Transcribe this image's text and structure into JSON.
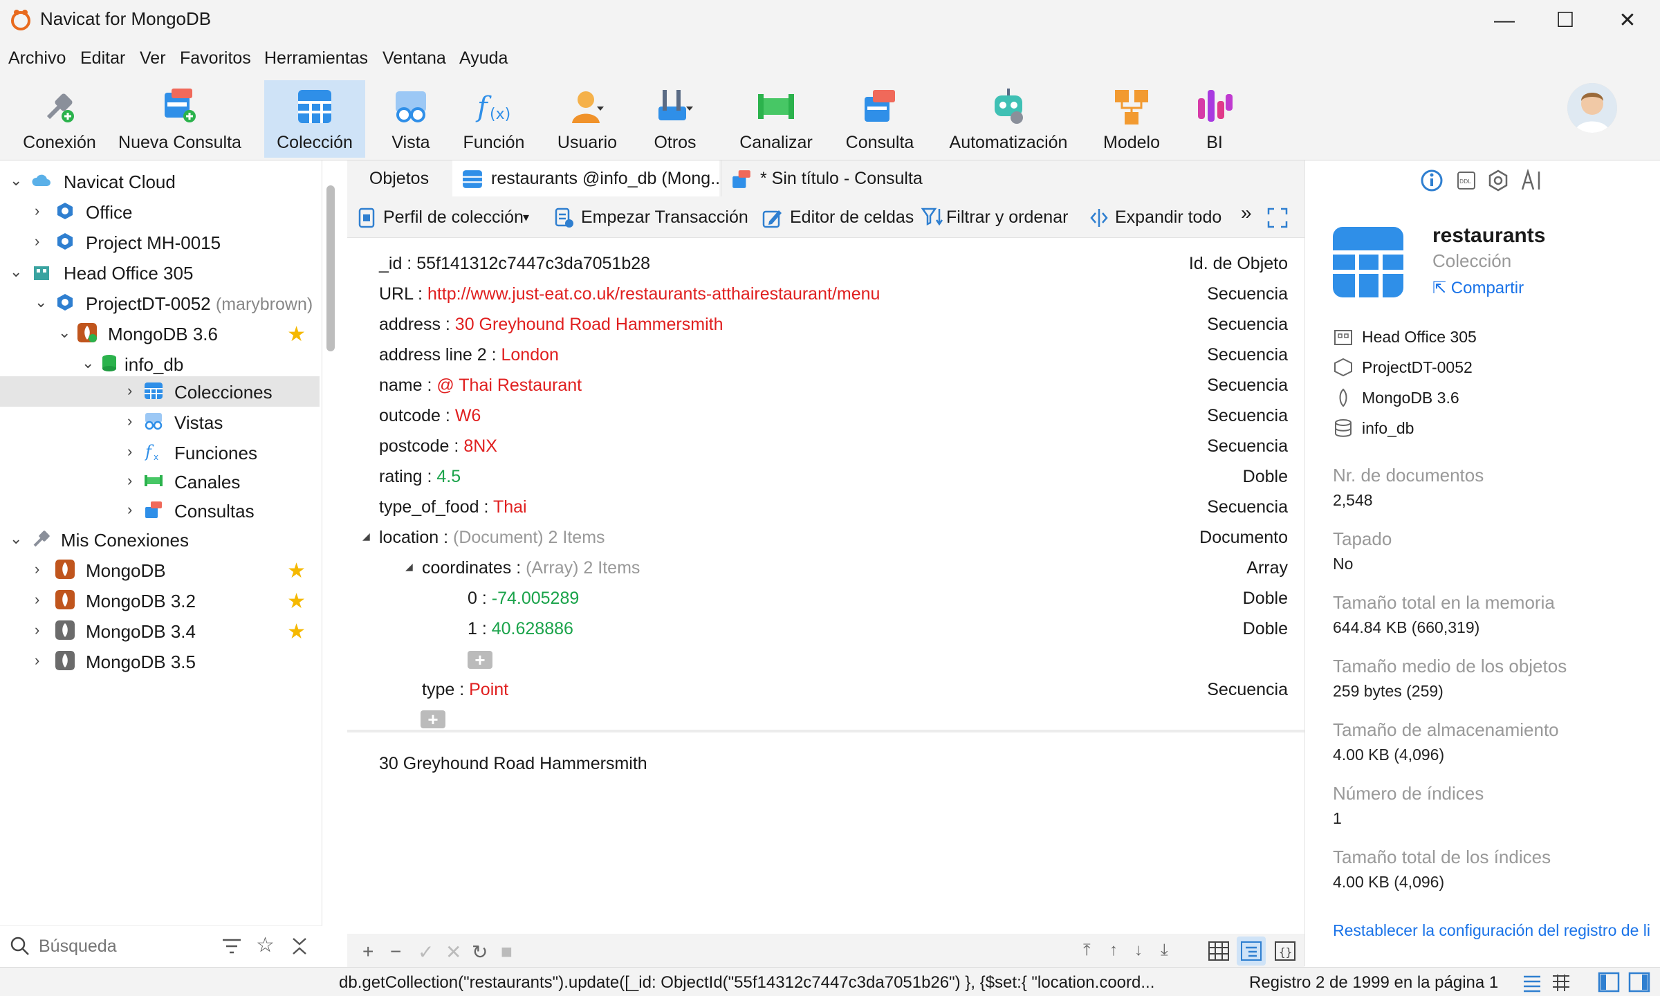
{
  "window": {
    "title": "Navicat for MongoDB",
    "minimize": "—",
    "maximize": "☐",
    "close": "✕"
  },
  "menu": [
    "Archivo",
    "Editar",
    "Ver",
    "Favoritos",
    "Herramientas",
    "Ventana",
    "Ayuda"
  ],
  "toolbar": [
    {
      "label": "Conexión",
      "icon": "plug-icon"
    },
    {
      "label": "Nueva Consulta",
      "icon": "new-query-icon"
    },
    {
      "label": "Colección",
      "icon": "collection-icon"
    },
    {
      "label": "Vista",
      "icon": "view-icon"
    },
    {
      "label": "Función",
      "icon": "function-icon"
    },
    {
      "label": "Usuario",
      "icon": "user-icon"
    },
    {
      "label": "Otros",
      "icon": "tools-icon"
    },
    {
      "label": "Canalizar",
      "icon": "pipeline-icon"
    },
    {
      "label": "Consulta",
      "icon": "query-icon"
    },
    {
      "label": "Automatización",
      "icon": "robot-icon"
    },
    {
      "label": "Modelo",
      "icon": "model-icon"
    },
    {
      "label": "BI",
      "icon": "bi-icon"
    }
  ],
  "tree": [
    {
      "label": "Navicat Cloud",
      "sub": "",
      "star": false
    },
    {
      "label": "Office",
      "sub": "",
      "star": false
    },
    {
      "label": "Project MH-0015",
      "sub": "",
      "star": false
    },
    {
      "label": "Head Office 305",
      "sub": "",
      "star": false
    },
    {
      "label": "ProjectDT-0052",
      "sub": "(marybrown)",
      "star": false
    },
    {
      "label": "MongoDB 3.6",
      "sub": "",
      "star": true
    },
    {
      "label": "info_db",
      "sub": "",
      "star": false
    },
    {
      "label": "Colecciones",
      "sub": "",
      "star": false
    },
    {
      "label": "Vistas",
      "sub": "",
      "star": false
    },
    {
      "label": "Funciones",
      "sub": "",
      "star": false
    },
    {
      "label": "Canales",
      "sub": "",
      "star": false
    },
    {
      "label": "Consultas",
      "sub": "",
      "star": false
    },
    {
      "label": "Mis Conexiones",
      "sub": "",
      "star": false
    },
    {
      "label": "MongoDB",
      "sub": "",
      "star": true
    },
    {
      "label": "MongoDB 3.2",
      "sub": "",
      "star": true
    },
    {
      "label": "MongoDB 3.4",
      "sub": "",
      "star": true
    },
    {
      "label": "MongoDB 3.5",
      "sub": "",
      "star": false
    }
  ],
  "search": {
    "placeholder": "Búsqueda"
  },
  "tabs": [
    "Objetos",
    "restaurants @info_db (Mong...",
    "* Sin título - Consulta"
  ],
  "subtoolbar": [
    "Perfil de colección",
    "Empezar Transacción",
    "Editor de celdas",
    "Filtrar y ordenar",
    "Expandir todo"
  ],
  "document": [
    {
      "key": "_id :",
      "value": "55f141312c7447c3da7051b28",
      "type": "Id. de Objeto",
      "color": "black"
    },
    {
      "key": "URL :",
      "value": "http://www.just-eat.co.uk/restaurants-atthairestaurant/menu",
      "type": "Secuencia",
      "color": "red"
    },
    {
      "key": "address :",
      "value": "30 Greyhound Road Hammersmith",
      "type": "Secuencia",
      "color": "red"
    },
    {
      "key": "address line 2 :",
      "value": "London",
      "type": "Secuencia",
      "color": "red"
    },
    {
      "key": "name :",
      "value": "@ Thai Restaurant",
      "type": "Secuencia",
      "color": "red"
    },
    {
      "key": "outcode :",
      "value": "W6",
      "type": "Secuencia",
      "color": "red"
    },
    {
      "key": "postcode :",
      "value": "8NX",
      "type": "Secuencia",
      "color": "red"
    },
    {
      "key": "rating :",
      "value": "4.5",
      "type": "Doble",
      "color": "green"
    },
    {
      "key": "type_of_food :",
      "value": "Thai",
      "type": "Secuencia",
      "color": "red"
    },
    {
      "key": "location :",
      "value": "(Document) 2 Items",
      "type": "Documento",
      "color": "gray"
    },
    {
      "key": "coordinates :",
      "value": "(Array) 2 Items",
      "type": "Array",
      "color": "gray"
    },
    {
      "key": "0 :",
      "value": "-74.005289",
      "type": "Doble",
      "color": "green"
    },
    {
      "key": "1 :",
      "value": "40.628886",
      "type": "Doble",
      "color": "green"
    },
    {
      "key": "type :",
      "value": "Point",
      "type": "Secuencia",
      "color": "red"
    }
  ],
  "preview": "30 Greyhound Road Hammersmith",
  "right": {
    "title": "restaurants",
    "subtitle": "Colección",
    "share": "Compartir",
    "path": [
      "Head Office 305",
      "ProjectDT-0052",
      "MongoDB 3.6",
      "info_db"
    ],
    "stats": [
      {
        "label": "Nr. de documentos",
        "value": "2,548"
      },
      {
        "label": "Tapado",
        "value": "No"
      },
      {
        "label": "Tamaño total en la memoria",
        "value": "644.84 KB (660,319)"
      },
      {
        "label": "Tamaño medio de los objetos",
        "value": "259 bytes (259)"
      },
      {
        "label": "Tamaño de almacenamiento",
        "value": "4.00 KB (4,096)"
      },
      {
        "label": "Número de índices",
        "value": "1"
      },
      {
        "label": "Tamaño total de los índices",
        "value": "4.00 KB (4,096)"
      }
    ],
    "reset": "Restablecer la configuración del registro de li"
  },
  "status": {
    "query": "db.getCollection(\"restaurants\").update([_id: ObjectId(\"55f14312c7447c3da7051b26\") }, {$set:{ \"location.coord...",
    "record": "Registro 2 de 1999 en la página 1"
  },
  "colors": {
    "accent": "#1a73e8",
    "selected": "#cfe3f7",
    "string": "#e02020",
    "number": "#1aa34a",
    "star": "#f5b800"
  }
}
